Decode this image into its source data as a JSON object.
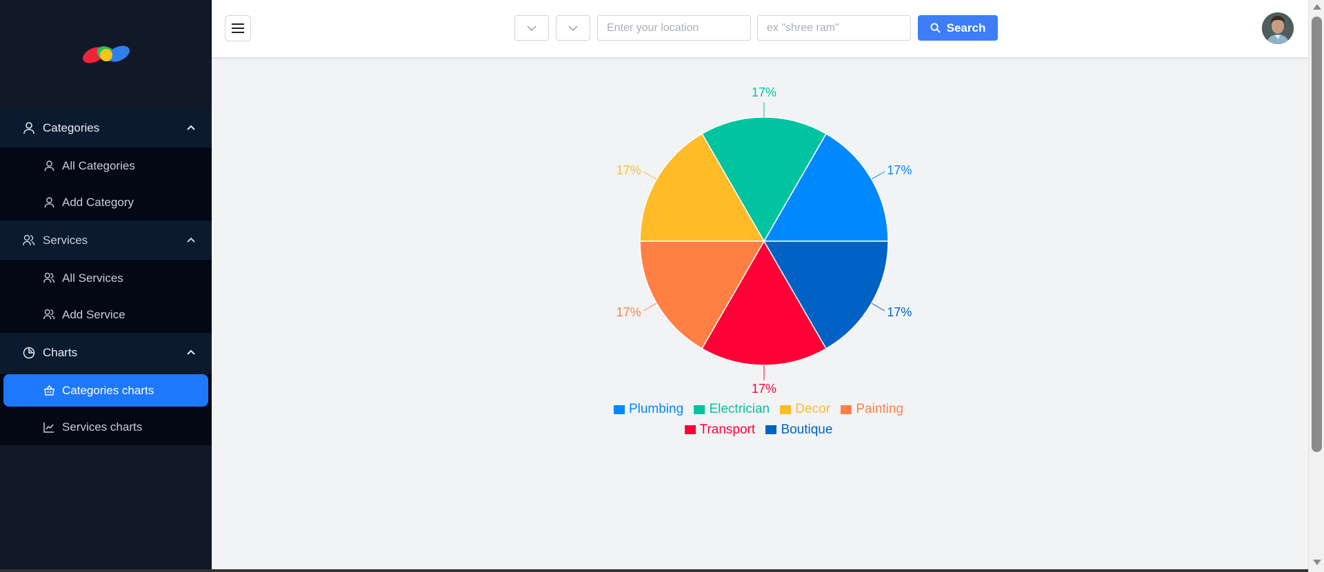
{
  "sidebar": {
    "groups": [
      {
        "label": "Categories",
        "icon": "user-icon",
        "items": [
          {
            "label": "All Categories",
            "icon": "user-icon"
          },
          {
            "label": "Add Category",
            "icon": "user-icon"
          }
        ]
      },
      {
        "label": "Services",
        "icon": "users-icon",
        "items": [
          {
            "label": "All Services",
            "icon": "users-icon"
          },
          {
            "label": "Add Service",
            "icon": "users-icon"
          }
        ]
      },
      {
        "label": "Charts",
        "icon": "pie-chart-icon",
        "items": [
          {
            "label": "Categories charts",
            "icon": "basket-icon",
            "active": true
          },
          {
            "label": "Services charts",
            "icon": "bar-chart-icon"
          }
        ]
      }
    ]
  },
  "topbar": {
    "location_placeholder": "Enter your location",
    "query_placeholder": "ex \"shree ram\"",
    "search_label": "Search"
  },
  "colors": {
    "accent": "#1d78fb",
    "sidebar_bg": "#111827",
    "search_button": "#3d7ef8"
  },
  "chart_data": {
    "type": "pie",
    "categories": [
      "Plumbing",
      "Electrician",
      "Decor",
      "Painting",
      "Transport",
      "Boutique"
    ],
    "values": [
      1,
      1,
      1,
      1,
      1,
      1
    ],
    "labels": [
      "17%",
      "17%",
      "17%",
      "17%",
      "17%",
      "17%"
    ],
    "colors": [
      "#0088fe",
      "#00c49f",
      "#ffbb28",
      "#ff8042",
      "#ff0036",
      "#0062c4"
    ],
    "legend_position": "bottom"
  }
}
